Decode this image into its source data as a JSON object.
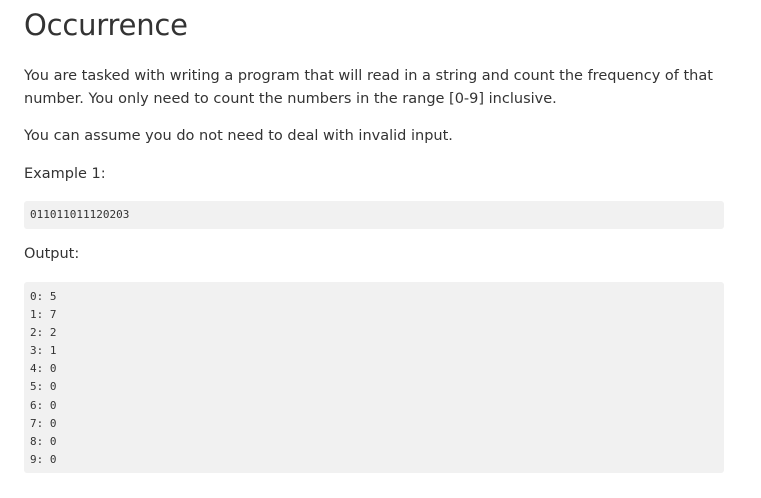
{
  "title": "Occurrence",
  "paragraphs": {
    "intro": "You are tasked with writing a program that will read in a string and count the frequency of that number. You only need to count the numbers in the range [0-9] inclusive.",
    "assume": "You can assume you do not need to deal with invalid input.",
    "example_label": "Example 1:",
    "output_label": "Output:"
  },
  "example_input": "011011011120203",
  "output_lines": [
    "0: 5",
    "1: 7",
    "2: 2",
    "3: 1",
    "4: 0",
    "5: 0",
    "6: 0",
    "7: 0",
    "8: 0",
    "9: 0"
  ]
}
